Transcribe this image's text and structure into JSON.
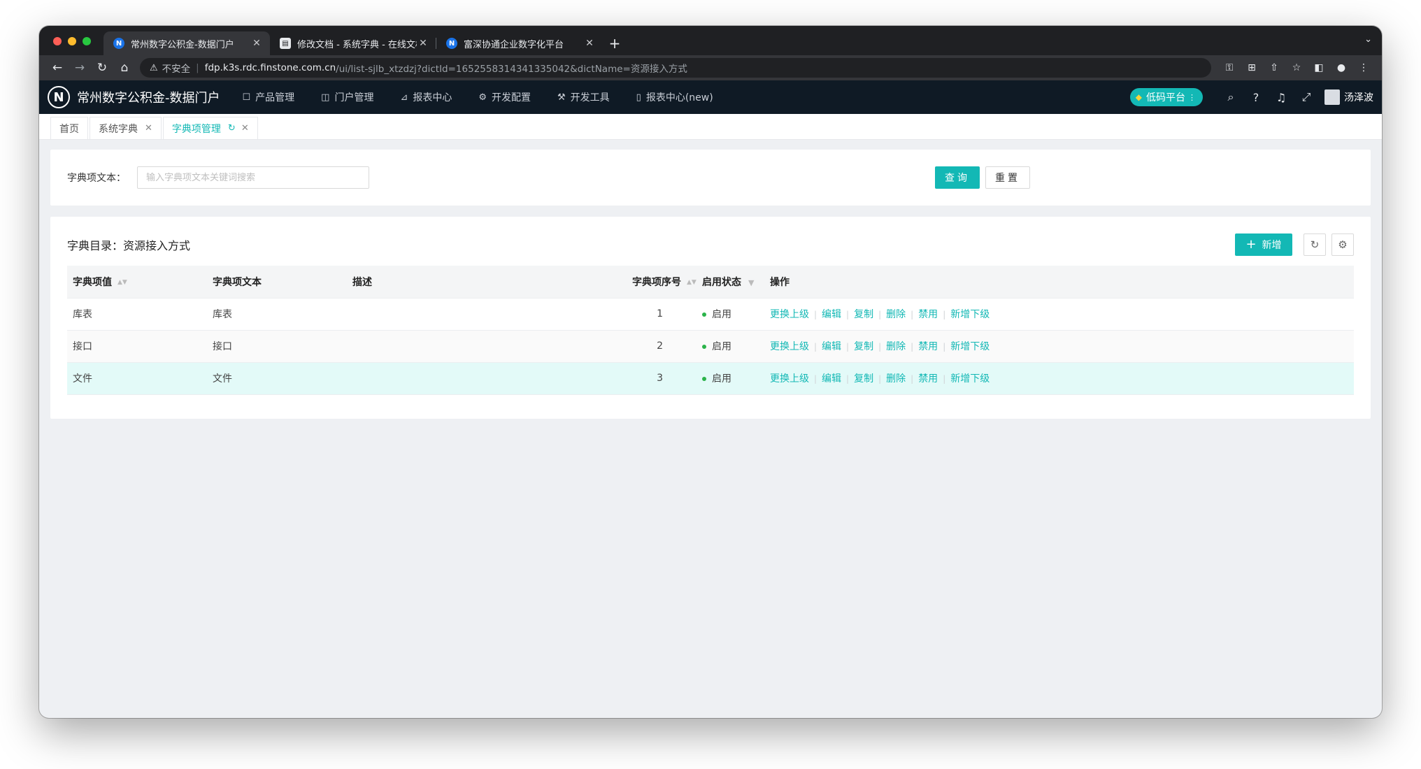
{
  "browser": {
    "tabs": [
      {
        "favicon": "N",
        "title": "常州数字公积金-数据门户",
        "active": true
      },
      {
        "favicon": "doc",
        "title": "修改文档 - 系统字典 - 在线文档",
        "active": false
      },
      {
        "favicon": "N",
        "title": "富深协通企业数字化平台",
        "active": false
      }
    ],
    "new_tab_label": "+",
    "address": {
      "insecure_label": "不安全",
      "host": "fdp.k3s.rdc.finstone.com.cn",
      "path": "/ui/list-sjlb_xtzdzj?dictId=1652558314341335042&dictName=资源接入方式"
    }
  },
  "app": {
    "logo_letter": "N",
    "title": "常州数字公积金-数据门户",
    "menu": [
      {
        "icon": "box-icon",
        "glyph": "☐",
        "label": "产品管理"
      },
      {
        "icon": "layout-icon",
        "glyph": "◫",
        "label": "门户管理"
      },
      {
        "icon": "chart-icon",
        "glyph": "⊿",
        "label": "报表中心"
      },
      {
        "icon": "gear-icon",
        "glyph": "⚙",
        "label": "开发配置"
      },
      {
        "icon": "wrench-icon",
        "glyph": "⚒",
        "label": "开发工具"
      },
      {
        "icon": "file-icon",
        "glyph": "▯",
        "label": "报表中心(new)"
      }
    ],
    "lowcode_label": "低码平台",
    "username": "汤泽波"
  },
  "page_tabs": [
    {
      "label": "首页",
      "closable": false
    },
    {
      "label": "系统字典",
      "closable": true
    },
    {
      "label": "字典项管理",
      "closable": true,
      "active": true
    }
  ],
  "search": {
    "label": "字典项文本：",
    "placeholder": "输入字典项文本关键词搜索",
    "query_label": "查询",
    "reset_label": "重置"
  },
  "list": {
    "title": "字典目录：资源接入方式",
    "add_label": "新增",
    "columns": [
      "字典项值",
      "字典项文本",
      "描述",
      "字典项序号",
      "启用状态",
      "操作"
    ],
    "rows": [
      {
        "value": "库表",
        "text": "库表",
        "desc": "",
        "order": "1",
        "status": "启用"
      },
      {
        "value": "接口",
        "text": "接口",
        "desc": "",
        "order": "2",
        "status": "启用"
      },
      {
        "value": "文件",
        "text": "文件",
        "desc": "",
        "order": "3",
        "status": "启用"
      }
    ],
    "ops": [
      "更换上级",
      "编辑",
      "复制",
      "删除",
      "禁用",
      "新增下级"
    ]
  },
  "colors": {
    "accent": "#13b8b5",
    "header_bg": "#0f1a25",
    "status_on": "#2bb34a",
    "row_highlight": "#e3faf8"
  }
}
